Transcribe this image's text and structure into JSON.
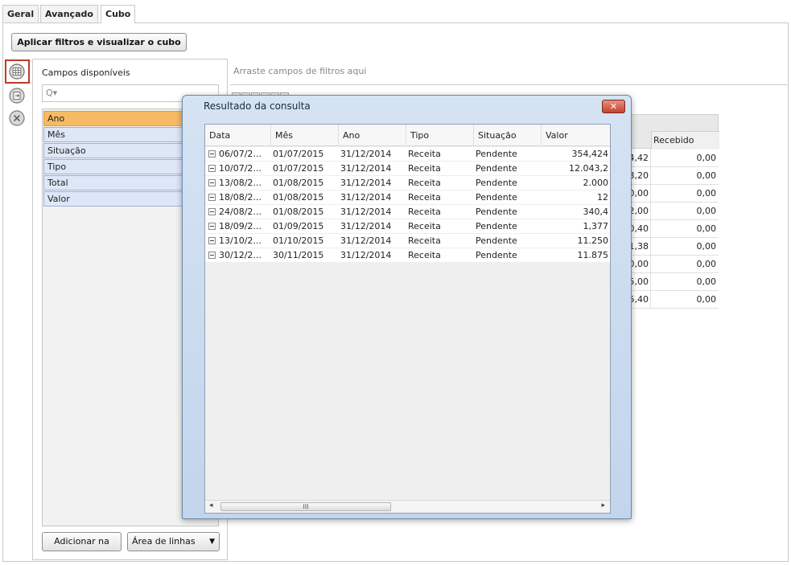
{
  "tabs": [
    {
      "label": "Geral"
    },
    {
      "label": "Avançado"
    },
    {
      "label": "Cubo"
    }
  ],
  "toolbar": {
    "apply_label": "Aplicar filtros e visualizar o cubo"
  },
  "side_icons": [
    "grid-icon",
    "export-icon",
    "clear-icon"
  ],
  "fields_panel": {
    "title": "Campos disponíveis",
    "search_glyph": "Q▾",
    "items": [
      {
        "label": "Ano"
      },
      {
        "label": "Mês"
      },
      {
        "label": "Situação"
      },
      {
        "label": "Tipo"
      },
      {
        "label": "Total"
      },
      {
        "label": "Valor"
      }
    ],
    "add_label": "Adicionar na",
    "area_select": "Área de linhas"
  },
  "drop_hint": "Arraste campos de filtros aqui",
  "background_grid": {
    "header": "Recebido",
    "rows": [
      {
        "a": "4,42",
        "b": "0,00"
      },
      {
        "a": "3,20",
        "b": "0,00"
      },
      {
        "a": "0,00",
        "b": "0,00"
      },
      {
        "a": "2,00",
        "b": "0,00"
      },
      {
        "a": "0,40",
        "b": "0,00"
      },
      {
        "a": "1,38",
        "b": "0,00"
      },
      {
        "a": "0,00",
        "b": "0,00"
      },
      {
        "a": "5,00",
        "b": "0,00"
      },
      {
        "a": "5,40",
        "b": "0,00"
      }
    ]
  },
  "dialog": {
    "title": "Resultado da consulta",
    "close_glyph": "✕",
    "columns": [
      "Data",
      "Mês",
      "Ano",
      "Tipo",
      "Situação",
      "Valor"
    ],
    "rows": [
      {
        "data": "06/07/2...",
        "mes": "01/07/2015",
        "ano": "31/12/2014",
        "tipo": "Receita",
        "situacao": "Pendente",
        "valor": "354,424"
      },
      {
        "data": "10/07/2...",
        "mes": "01/07/2015",
        "ano": "31/12/2014",
        "tipo": "Receita",
        "situacao": "Pendente",
        "valor": "12.043,2"
      },
      {
        "data": "13/08/2...",
        "mes": "01/08/2015",
        "ano": "31/12/2014",
        "tipo": "Receita",
        "situacao": "Pendente",
        "valor": "2.000"
      },
      {
        "data": "18/08/2...",
        "mes": "01/08/2015",
        "ano": "31/12/2014",
        "tipo": "Receita",
        "situacao": "Pendente",
        "valor": "12"
      },
      {
        "data": "24/08/2...",
        "mes": "01/08/2015",
        "ano": "31/12/2014",
        "tipo": "Receita",
        "situacao": "Pendente",
        "valor": "340,4"
      },
      {
        "data": "18/09/2...",
        "mes": "01/09/2015",
        "ano": "31/12/2014",
        "tipo": "Receita",
        "situacao": "Pendente",
        "valor": "1,377"
      },
      {
        "data": "13/10/2...",
        "mes": "01/10/2015",
        "ano": "31/12/2014",
        "tipo": "Receita",
        "situacao": "Pendente",
        "valor": "11.250"
      },
      {
        "data": "30/12/2...",
        "mes": "30/11/2015",
        "ano": "31/12/2014",
        "tipo": "Receita",
        "situacao": "Pendente",
        "valor": "11.875"
      }
    ],
    "scroll_grip": "III"
  }
}
